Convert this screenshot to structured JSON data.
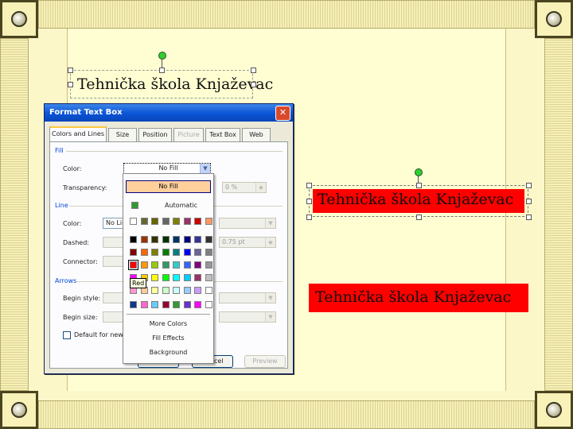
{
  "slide": {
    "textbox_text": "Tehnička škola Knjaževac"
  },
  "dialog": {
    "title": "Format Text Box",
    "close_glyph": "✕",
    "tabs": [
      "Colors and Lines",
      "Size",
      "Position",
      "Picture",
      "Text Box",
      "Web"
    ],
    "fill": {
      "section": "Fill",
      "color_label": "Color:",
      "color_value": "No Fill",
      "transparency_label": "Transparency:",
      "transparency_value": "0 %"
    },
    "line": {
      "section": "Line",
      "color_label": "Color:",
      "color_value": "No Line",
      "dashed_label": "Dashed:",
      "connector_label": "Connector:",
      "weight_value": "0.75 pt"
    },
    "arrows": {
      "section": "Arrows",
      "begin_style_label": "Begin style:",
      "begin_size_label": "Begin size:"
    },
    "default_checkbox_label": "Default for new objects",
    "buttons": {
      "ok": "OK",
      "cancel": "Cancel",
      "preview": "Preview"
    }
  },
  "color_popup": {
    "no_fill": "No Fill",
    "automatic": "Automatic",
    "recent_colors": [
      "#ffffff",
      "#666633",
      "#666600",
      "#666666",
      "#808000",
      "#993366",
      "#cc0000",
      "#ff9966"
    ],
    "standard_colors": [
      [
        "#000000",
        "#993300",
        "#333300",
        "#003300",
        "#003366",
        "#000080",
        "#333399",
        "#333333"
      ],
      [
        "#800000",
        "#ff6600",
        "#808000",
        "#008000",
        "#008080",
        "#0000ff",
        "#666699",
        "#808080"
      ],
      [
        "#ff0000",
        "#ff9900",
        "#99cc00",
        "#339966",
        "#33cccc",
        "#3366ff",
        "#800080",
        "#969696"
      ],
      [
        "#ff00ff",
        "#ffcc00",
        "#ffff00",
        "#00ff00",
        "#00ffff",
        "#00ccff",
        "#993366",
        "#c0c0c0"
      ],
      [
        "#ff99cc",
        "#ffcc99",
        "#ffff99",
        "#ccffcc",
        "#ccffff",
        "#99ccff",
        "#cc99ff",
        "#ffffff"
      ]
    ],
    "scheme_colors": [
      "#0c3a8c",
      "#ff66cc",
      "#66ccff",
      "#990033",
      "#339933",
      "#6633cc",
      "#ff00ff",
      "#ffffff"
    ],
    "tooltip": "Red",
    "more_colors": "More Colors",
    "fill_effects": "Fill Effects",
    "background": "Background"
  }
}
